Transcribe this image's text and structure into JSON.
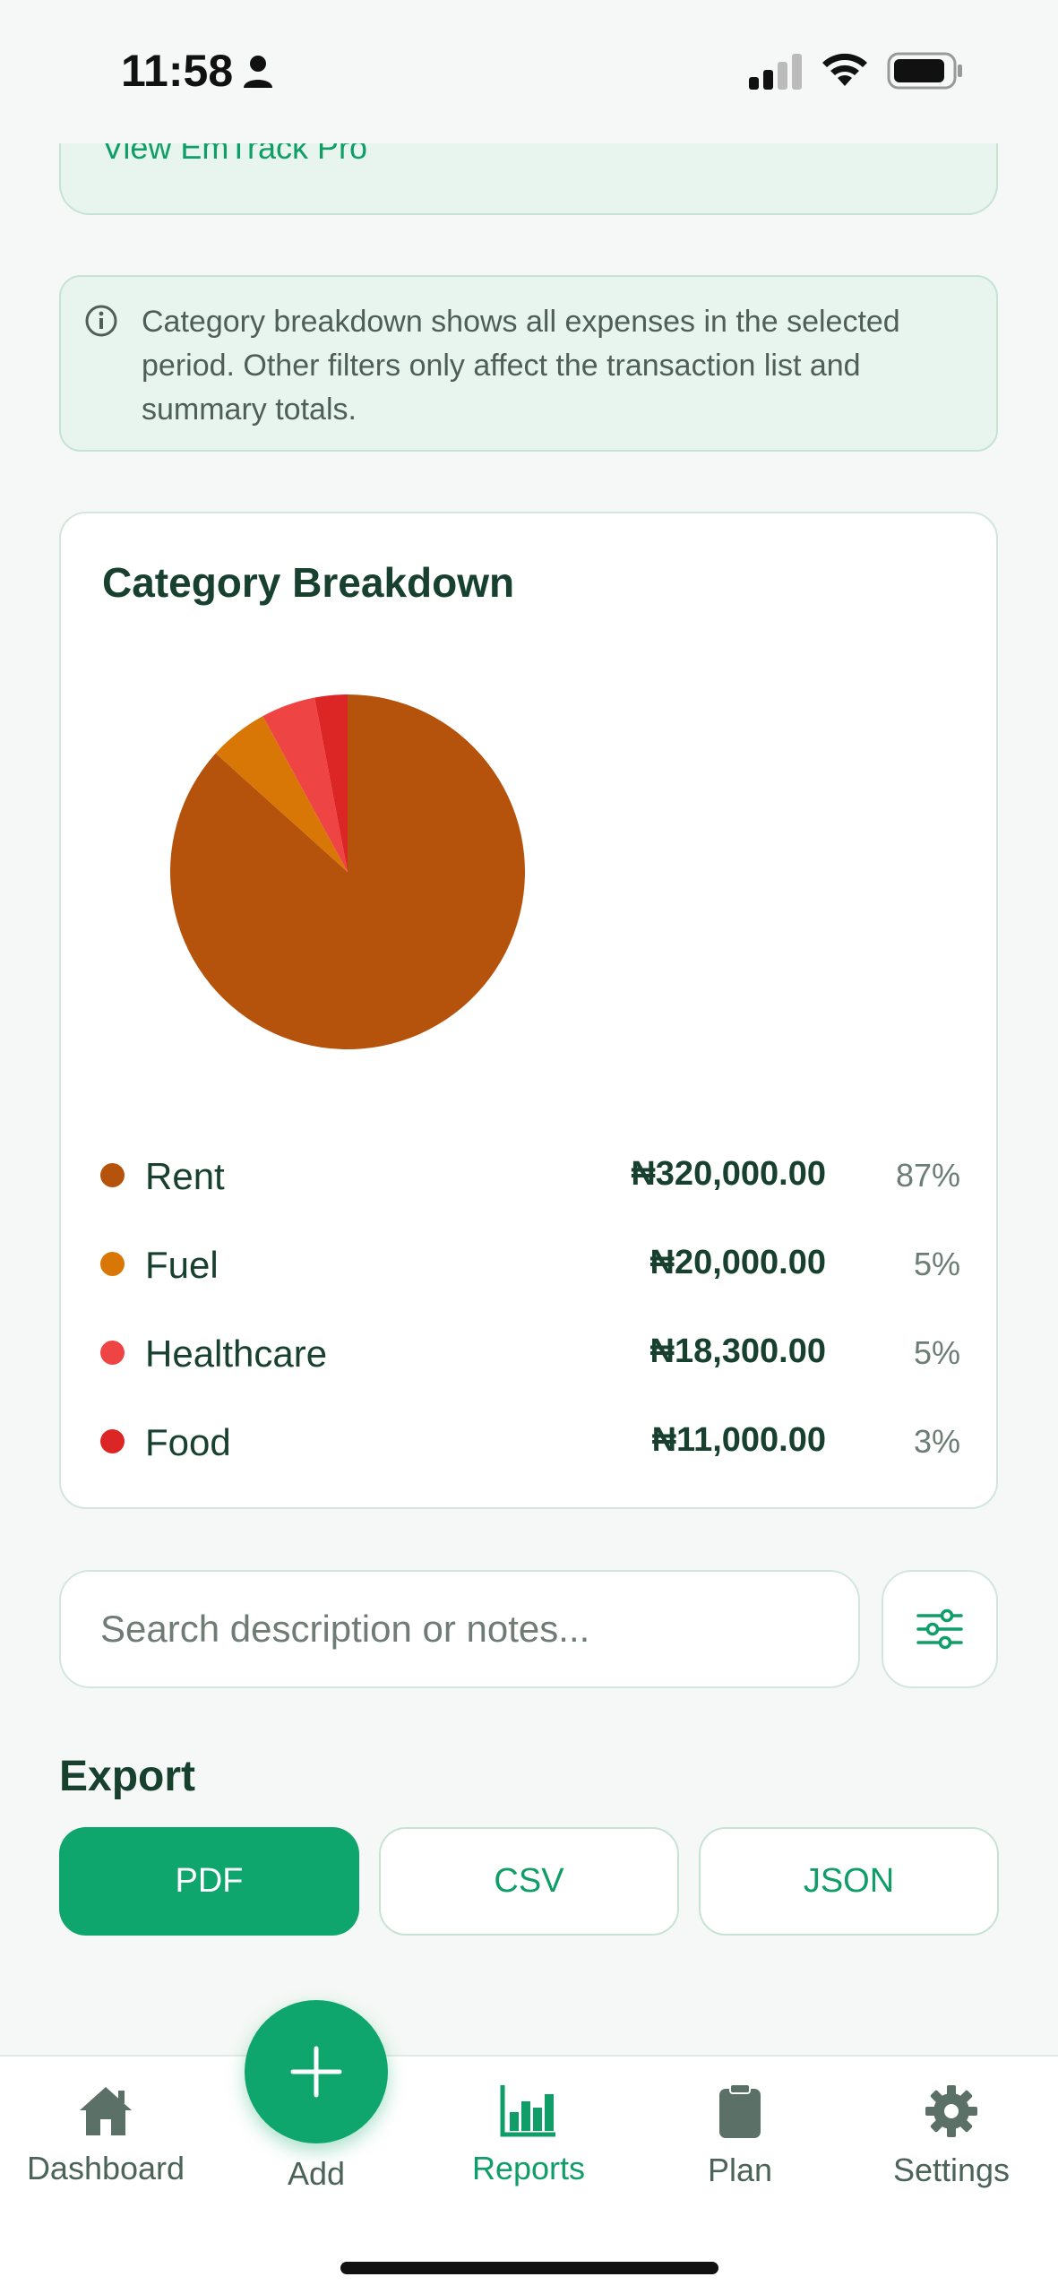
{
  "status_bar": {
    "time": "11:58"
  },
  "pro_card": {
    "link": "View EmTrack Pro"
  },
  "info": {
    "text": "Category breakdown shows all expenses in the selected period. Other filters only affect the transaction list and summary totals."
  },
  "breakdown": {
    "title": "Category Breakdown",
    "items": [
      {
        "name": "Rent",
        "amount": "₦320,000.00",
        "percent": "87%",
        "color": "#b5530c"
      },
      {
        "name": "Fuel",
        "amount": "₦20,000.00",
        "percent": "5%",
        "color": "#d97706"
      },
      {
        "name": "Healthcare",
        "amount": "₦18,300.00",
        "percent": "5%",
        "color": "#ef4444"
      },
      {
        "name": "Food",
        "amount": "₦11,000.00",
        "percent": "3%",
        "color": "#dc2626"
      }
    ]
  },
  "chart_data": {
    "type": "pie",
    "categories": [
      "Rent",
      "Fuel",
      "Healthcare",
      "Food"
    ],
    "values": [
      320000,
      20000,
      18300,
      11000
    ],
    "colors": [
      "#b5530c",
      "#d97706",
      "#ef4444",
      "#dc2626"
    ]
  },
  "search": {
    "placeholder": "Search description or notes..."
  },
  "export": {
    "title": "Export",
    "buttons": [
      {
        "label": "PDF"
      },
      {
        "label": "CSV"
      },
      {
        "label": "JSON"
      }
    ]
  },
  "tabs": [
    {
      "label": "Dashboard",
      "icon": "home-icon"
    },
    {
      "label": "Add",
      "icon": "plus-icon"
    },
    {
      "label": "Reports",
      "icon": "bar-chart-icon"
    },
    {
      "label": "Plan",
      "icon": "clipboard-icon"
    },
    {
      "label": "Settings",
      "icon": "gear-icon"
    }
  ],
  "theme": {
    "accent": "#0ea66c",
    "heading": "#17402f"
  }
}
